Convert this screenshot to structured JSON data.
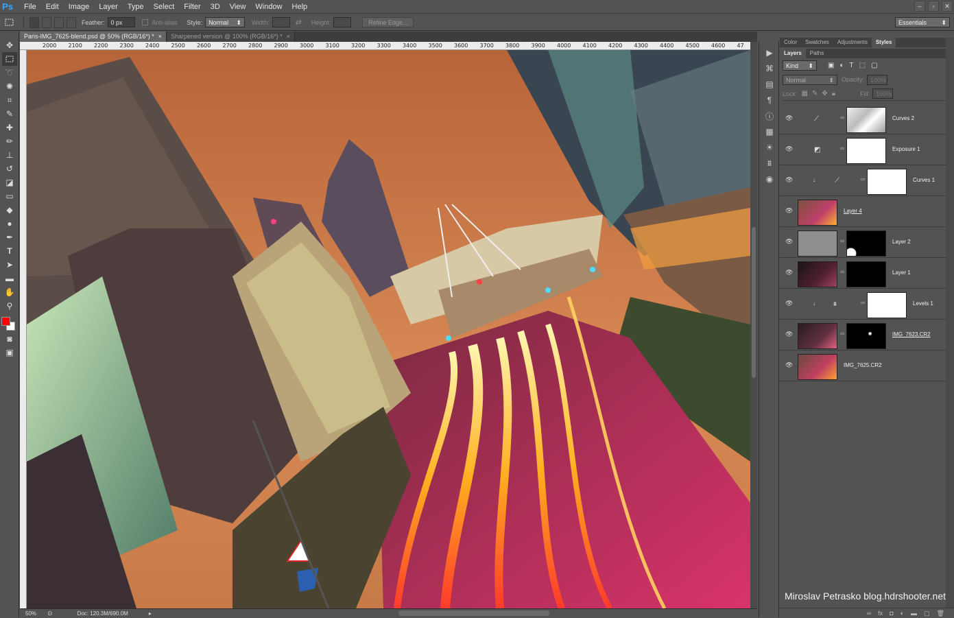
{
  "app": {
    "logo": "Ps"
  },
  "menu": [
    "File",
    "Edit",
    "Image",
    "Layer",
    "Type",
    "Select",
    "Filter",
    "3D",
    "View",
    "Window",
    "Help"
  ],
  "window_controls": {
    "minimize": "–",
    "maximize": "▫",
    "close": "✕"
  },
  "options_bar": {
    "feather_label": "Feather:",
    "feather_value": "0 px",
    "antialias_label": "Anti-alias",
    "style_label": "Style:",
    "style_value": "Normal",
    "width_label": "Width:",
    "height_label": "Height:",
    "refine_edge": "Refine Edge...",
    "workspace": "Essentials"
  },
  "tabs": [
    {
      "label": "Paris-IMG_7625-blend.psd @ 50% (RGB/16*) *",
      "close": "×"
    },
    {
      "label": "Sharpened version @ 100% (RGB/16*) *",
      "close": "×"
    }
  ],
  "ruler_ticks": [
    "2000",
    "2100",
    "2200",
    "2300",
    "2400",
    "2500",
    "2600",
    "2700",
    "2800",
    "2900",
    "3000",
    "3100",
    "3200",
    "3300",
    "3400",
    "3500",
    "3600",
    "3700",
    "3800",
    "3900",
    "4000",
    "4100",
    "4200",
    "4300",
    "4400",
    "4500",
    "4600",
    "47"
  ],
  "status": {
    "zoom": "50%",
    "doc": "Doc: 120.3M/690.0M"
  },
  "colors": {
    "foreground": "#ff0000",
    "background": "#ffffff",
    "accent": "#31a8ff"
  },
  "panel": {
    "top_tabs": [
      "Color",
      "Swatches",
      "Adjustments",
      "Styles"
    ],
    "layer_tabs": [
      "Layers",
      "Paths"
    ],
    "kind": "Kind",
    "blend_mode": "Normal",
    "opacity_label": "Opacity:",
    "opacity_value": "100%",
    "lock_label": "Lock:",
    "fill_label": "Fill:",
    "fill_value": "100%"
  },
  "layers": [
    {
      "name": "Curves 2",
      "kind": "adjustment"
    },
    {
      "name": "Exposure 1",
      "kind": "adjustment"
    },
    {
      "name": "Curves 1",
      "kind": "clipped-adjustment"
    },
    {
      "name": "Layer 4",
      "kind": "image"
    },
    {
      "name": "Layer 2",
      "kind": "masked"
    },
    {
      "name": "Layer 1",
      "kind": "masked"
    },
    {
      "name": "Levels 1",
      "kind": "clipped-adjustment"
    },
    {
      "name": "IMG_7623.CR2",
      "kind": "masked"
    },
    {
      "name": "IMG_7625.CR2",
      "kind": "image"
    }
  ],
  "watermark": "Miroslav  Petrasko  blog.hdrshooter.net"
}
